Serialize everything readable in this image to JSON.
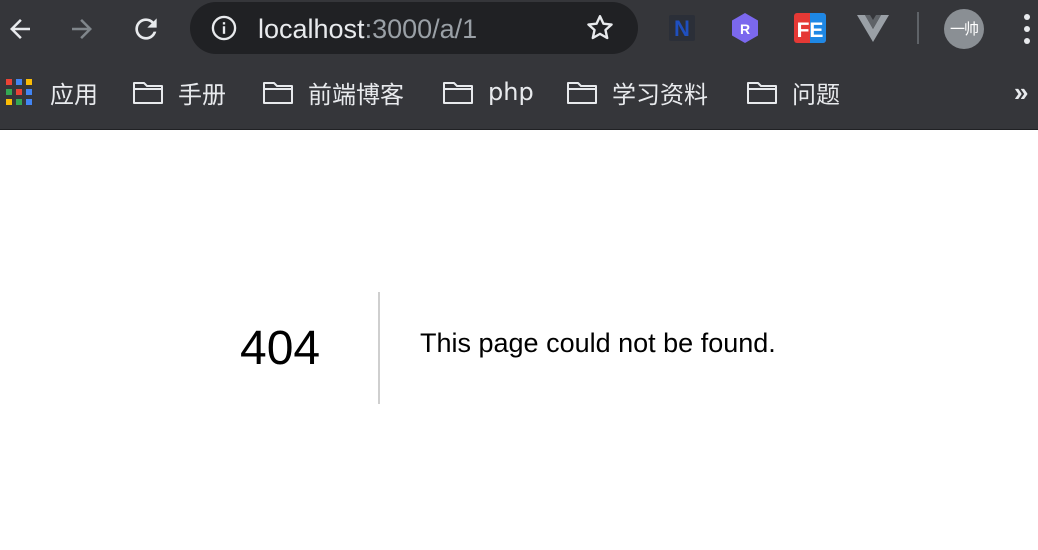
{
  "browser": {
    "toolbar": {
      "back_icon": "arrow-left-icon",
      "forward_icon": "arrow-right-icon",
      "reload_icon": "reload-icon",
      "url_host": "localhost",
      "url_path": ":3000/a/1",
      "info_icon": "info-icon",
      "bookmark_star_icon": "star-icon",
      "extensions": [
        {
          "name": "N",
          "icon": "n-extension-icon",
          "color": "#1a2a6c"
        },
        {
          "name": "R",
          "icon": "r-extension-icon",
          "color": "#7b68ee"
        },
        {
          "name": "FE",
          "icon": "fe-extension-icon",
          "color": "#e53935"
        },
        {
          "name": "V",
          "icon": "vue-devtools-icon",
          "color": "#9aa0a6"
        }
      ],
      "profile_label": "一帅",
      "menu_icon": "more-vert-icon"
    },
    "bookmarks": {
      "apps_label": "应用",
      "items": [
        {
          "label": "手册"
        },
        {
          "label": "前端博客"
        },
        {
          "label": "php"
        },
        {
          "label": "学习资料"
        },
        {
          "label": "问题"
        }
      ],
      "overflow": "»"
    },
    "colors": {
      "chrome_dark": "#35363a",
      "omnibox_bg": "#202124",
      "text_light": "#e8eaed"
    }
  },
  "page": {
    "error_code": "404",
    "error_message": "This page could not be found."
  }
}
